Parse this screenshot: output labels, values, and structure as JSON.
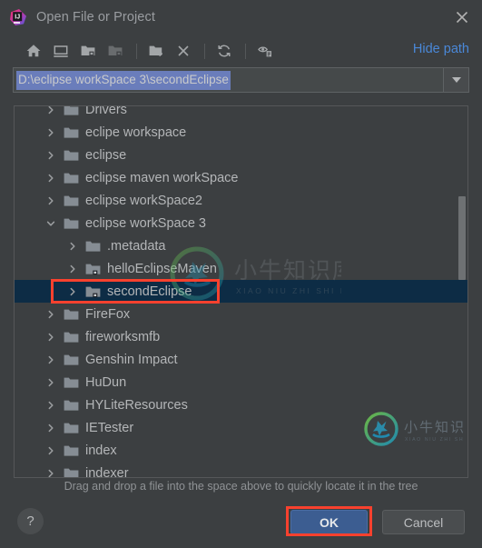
{
  "window": {
    "title": "Open File or Project",
    "app_icon": "intellij-idea-icon",
    "close_icon": "close-icon"
  },
  "toolbar": {
    "items": [
      {
        "name": "home-icon",
        "label": "Home",
        "enabled": true
      },
      {
        "name": "desktop-icon",
        "label": "Desktop",
        "enabled": true
      },
      {
        "name": "project-folder-icon",
        "label": "Project Folder",
        "enabled": true
      },
      {
        "name": "module-folder-icon",
        "label": "Module Folder",
        "enabled": false
      },
      {
        "name": "new-folder-icon",
        "label": "New Folder",
        "enabled": true
      },
      {
        "name": "delete-icon",
        "label": "Delete",
        "enabled": true
      },
      {
        "name": "refresh-icon",
        "label": "Refresh",
        "enabled": true
      },
      {
        "name": "show-hidden-icon",
        "label": "Show Hidden Files",
        "enabled": true
      }
    ],
    "hide_path_label": "Hide path"
  },
  "path_field": {
    "value": "D:\\eclipse workSpace 3\\secondEclipse",
    "placeholder": "",
    "selected": true,
    "dropdown_icon": "chevron-down-icon"
  },
  "tree": {
    "rows": [
      {
        "label": "Drivers",
        "depth": 1,
        "expanded": false,
        "icon": "folder-icon",
        "selected": false
      },
      {
        "label": "eclipe workspace",
        "depth": 1,
        "expanded": false,
        "icon": "folder-icon",
        "selected": false
      },
      {
        "label": "eclipse",
        "depth": 1,
        "expanded": false,
        "icon": "folder-icon",
        "selected": false
      },
      {
        "label": "eclipse maven workSpace",
        "depth": 1,
        "expanded": false,
        "icon": "folder-icon",
        "selected": false
      },
      {
        "label": "eclipse workSpace2",
        "depth": 1,
        "expanded": false,
        "icon": "folder-icon",
        "selected": false
      },
      {
        "label": "eclipse workSpace 3",
        "depth": 1,
        "expanded": true,
        "icon": "folder-icon",
        "selected": false
      },
      {
        "label": ".metadata",
        "depth": 2,
        "expanded": false,
        "icon": "folder-icon",
        "selected": false
      },
      {
        "label": "helloEclipseMaven",
        "depth": 2,
        "expanded": false,
        "icon": "module-folder-icon",
        "selected": false
      },
      {
        "label": "secondEclipse",
        "depth": 2,
        "expanded": false,
        "icon": "module-folder-icon",
        "selected": true
      },
      {
        "label": "FireFox",
        "depth": 1,
        "expanded": false,
        "icon": "folder-icon",
        "selected": false
      },
      {
        "label": "fireworksmfb",
        "depth": 1,
        "expanded": false,
        "icon": "folder-icon",
        "selected": false
      },
      {
        "label": "Genshin Impact",
        "depth": 1,
        "expanded": false,
        "icon": "folder-icon",
        "selected": false
      },
      {
        "label": "HuDun",
        "depth": 1,
        "expanded": false,
        "icon": "folder-icon",
        "selected": false
      },
      {
        "label": "HYLiteResources",
        "depth": 1,
        "expanded": false,
        "icon": "folder-icon",
        "selected": false
      },
      {
        "label": "IETester",
        "depth": 1,
        "expanded": false,
        "icon": "folder-icon",
        "selected": false
      },
      {
        "label": "index",
        "depth": 1,
        "expanded": false,
        "icon": "folder-icon",
        "selected": false
      },
      {
        "label": "indexer",
        "depth": 1,
        "expanded": false,
        "icon": "folder-icon",
        "selected": false
      }
    ]
  },
  "hint": "Drag and drop a file into the space above to quickly locate it in the tree",
  "footer": {
    "help_label": "?",
    "ok_label": "OK",
    "cancel_label": "Cancel"
  },
  "watermark": {
    "text_cn": "小牛知识库",
    "text_pinyin": "XIAO NIU ZHI SHI KU"
  },
  "colors": {
    "dialog_bg": "#3c3f41",
    "selection_row": "#0d2c45",
    "text_selection": "#6a7dbb",
    "link": "#4a88d8",
    "ok_button": "#3c5d91",
    "annotation_red": "#f8412e",
    "folder_icon": "#8a9097",
    "text": "#b4b6b8"
  }
}
